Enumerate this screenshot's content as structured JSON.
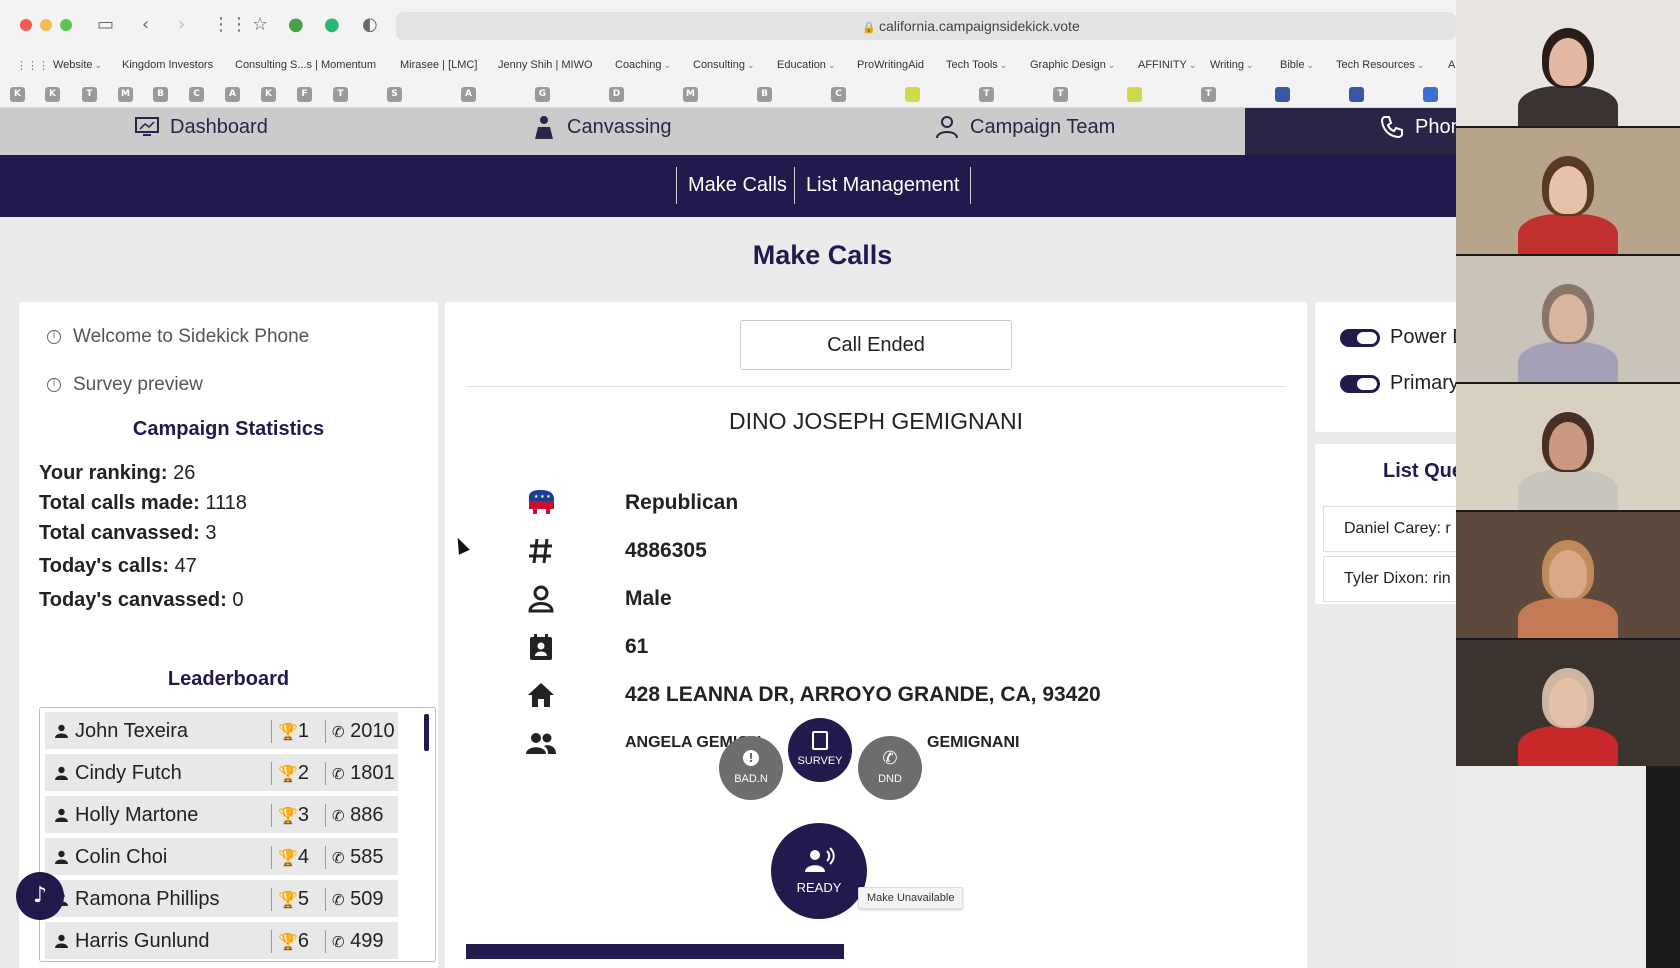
{
  "browser": {
    "url": "california.campaignsidekick.vote",
    "bookmarks": [
      {
        "label": "Website",
        "dropdown": true
      },
      {
        "label": "Kingdom Investors",
        "dropdown": false
      },
      {
        "label": "Consulting S...s | Momentum",
        "dropdown": false
      },
      {
        "label": "Mirasee | [LMC]",
        "dropdown": false
      },
      {
        "label": "Jenny Shih | MIWO",
        "dropdown": false
      },
      {
        "label": "Coaching",
        "dropdown": true
      },
      {
        "label": "Consulting",
        "dropdown": true
      },
      {
        "label": "Education",
        "dropdown": true
      },
      {
        "label": "ProWritingAid",
        "dropdown": false
      },
      {
        "label": "Tech Tools",
        "dropdown": true
      },
      {
        "label": "Graphic Design",
        "dropdown": true
      },
      {
        "label": "AFFINITY",
        "dropdown": true
      },
      {
        "label": "Writing",
        "dropdown": true
      },
      {
        "label": "Bible",
        "dropdown": true
      },
      {
        "label": "Tech Resources",
        "dropdown": true
      },
      {
        "label": "A",
        "dropdown": false
      }
    ],
    "favicons": [
      "K",
      "K",
      "T",
      "M",
      "B",
      "C",
      "A",
      "K",
      "F",
      "T",
      "S",
      "A",
      "G",
      "D",
      "M",
      "B",
      "C",
      "",
      "T",
      "T",
      "",
      "T",
      "",
      "",
      ""
    ]
  },
  "nav": {
    "dashboard": "Dashboard",
    "canvassing": "Canvassing",
    "campaign_team": "Campaign Team",
    "phone": "Phon"
  },
  "subnav": {
    "make_calls": "Make Calls",
    "list_management": "List Management"
  },
  "page_title": "Make Calls",
  "left": {
    "welcome": "Welcome to Sidekick Phone",
    "survey_preview": "Survey preview",
    "stats_heading": "Campaign Statistics",
    "stats": [
      {
        "label": "Your ranking:",
        "value": "26"
      },
      {
        "label": "Total calls made:",
        "value": "1118"
      },
      {
        "label": "Total canvassed:",
        "value": "3"
      },
      {
        "label": "Today's calls:",
        "value": "47"
      },
      {
        "label": "Today's canvassed:",
        "value": "0"
      }
    ],
    "leaderboard_heading": "Leaderboard",
    "leaderboard": [
      {
        "name": "John Texeira",
        "rank": "1",
        "calls": "2010"
      },
      {
        "name": "Cindy Futch",
        "rank": "2",
        "calls": "1801"
      },
      {
        "name": "Holly Martone",
        "rank": "3",
        "calls": "886"
      },
      {
        "name": "Colin Choi",
        "rank": "4",
        "calls": "585"
      },
      {
        "name": "Ramona Phillips",
        "rank": "5",
        "calls": "509"
      },
      {
        "name": "Harris Gunlund",
        "rank": "6",
        "calls": "499"
      }
    ]
  },
  "center": {
    "call_status": "Call Ended",
    "voter_name": "DINO JOSEPH GEMIGNANI",
    "party": "Republican",
    "voter_id": "4886305",
    "gender": "Male",
    "age": "61",
    "address": "428 LEANNA DR, ARROYO GRANDE, CA, 93420",
    "household": "ANGELA GEMIGN",
    "household_tail": "GEMIGNANI",
    "actions": {
      "bad_number": "BAD.N",
      "survey": "SURVEY",
      "dnd": "DND",
      "ready": "READY"
    },
    "tooltip": "Make Unavailable"
  },
  "right": {
    "toggle_1": "Power D",
    "toggle_2": "Primary",
    "list_queue_heading": "List Que",
    "queue": [
      {
        "name": "Daniel Carey:",
        "status": "r"
      },
      {
        "name": "Tyler Dixon:",
        "status": "rin"
      }
    ]
  },
  "colors": {
    "brand": "#22194d",
    "republican_red": "#c8102e",
    "republican_blue": "#1a3d8f"
  }
}
